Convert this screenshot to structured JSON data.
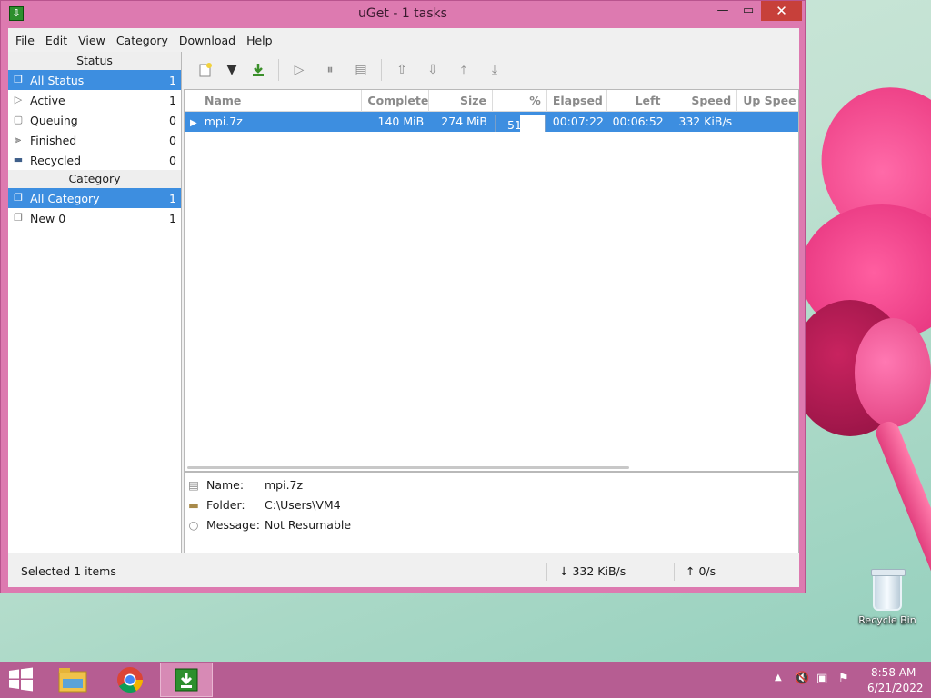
{
  "window": {
    "title": "uGet - 1 tasks",
    "app_icon": "uget-icon"
  },
  "menu": [
    "File",
    "Edit",
    "View",
    "Category",
    "Download",
    "Help"
  ],
  "sidebar": {
    "status_header": "Status",
    "status_items": [
      {
        "label": "All Status",
        "count": "1",
        "icon": "all-status-icon",
        "selected": true
      },
      {
        "label": "Active",
        "count": "1",
        "icon": "active-icon"
      },
      {
        "label": "Queuing",
        "count": "0",
        "icon": "queuing-icon"
      },
      {
        "label": "Finished",
        "count": "0",
        "icon": "finished-icon"
      },
      {
        "label": "Recycled",
        "count": "0",
        "icon": "recycled-icon"
      }
    ],
    "category_header": "Category",
    "category_items": [
      {
        "label": "All Category",
        "count": "1",
        "selected": true
      },
      {
        "label": "New 0",
        "count": "1"
      }
    ]
  },
  "toolbar": [
    "new-download-icon",
    "dropdown-icon",
    "new-batch-icon",
    "start-icon",
    "pause-icon",
    "properties-icon",
    "move-up-icon",
    "move-down-icon",
    "move-top-icon",
    "move-bottom-icon"
  ],
  "columns": {
    "name": "Name",
    "complete": "Complete",
    "size": "Size",
    "percent": "%",
    "elapsed": "Elapsed",
    "left": "Left",
    "speed": "Speed",
    "up_speed": "Up Spee"
  },
  "task": {
    "name": "mpi.7z",
    "complete": "140 MiB",
    "size": "274 MiB",
    "percent": "51%",
    "progress": 0.51,
    "elapsed": "00:07:22",
    "left": "00:06:52",
    "speed": "332 KiB/s",
    "up_speed": ""
  },
  "details": {
    "name_label": "Name:",
    "name_value": "mpi.7z",
    "folder_label": "Folder:",
    "folder_value": "C:\\Users\\VM4",
    "message_label": "Message:",
    "message_value": "Not Resumable"
  },
  "statusbar": {
    "selected": "Selected 1 items",
    "down": "↓ 332 KiB/s",
    "up": "↑ 0/s"
  },
  "desktop": {
    "recycle_bin": "Recycle Bin"
  },
  "taskbar": {
    "time": "8:58 AM",
    "date": "6/21/2022"
  },
  "colors": {
    "selection": "#3d8ee0",
    "window_frame": "#dd7ab0",
    "taskbar": "#b65d92"
  }
}
